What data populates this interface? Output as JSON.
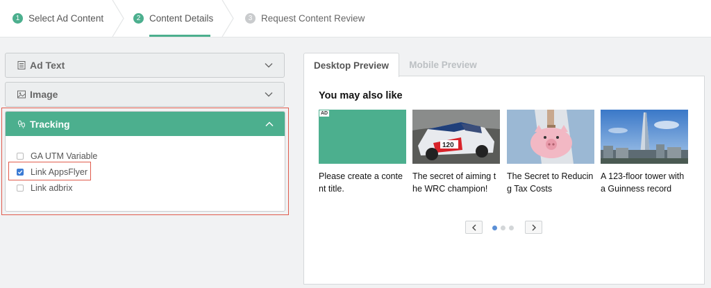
{
  "stepper": {
    "steps": [
      {
        "number": "1",
        "label": "Select Ad Content",
        "state": "done"
      },
      {
        "number": "2",
        "label": "Content Details",
        "state": "active"
      },
      {
        "number": "3",
        "label": "Request Content Review",
        "state": "todo"
      }
    ]
  },
  "sections": {
    "ad_text": {
      "label": "Ad Text",
      "icon": "document-icon",
      "expanded": false
    },
    "image": {
      "label": "Image",
      "icon": "image-icon",
      "expanded": false
    },
    "tracking": {
      "label": "Tracking",
      "icon": "footprints-icon",
      "expanded": true,
      "options": [
        {
          "label": "GA UTM Variable",
          "checked": false
        },
        {
          "label": "Link AppsFlyer",
          "checked": true
        },
        {
          "label": "Link adbrix",
          "checked": false
        }
      ]
    }
  },
  "preview": {
    "tabs": [
      {
        "label": "Desktop Preview",
        "active": true
      },
      {
        "label": "Mobile Preview",
        "active": false
      }
    ],
    "title": "You may also like",
    "cards": [
      {
        "title": "Please create a content title.",
        "badge": "AD",
        "thumb": "placeholder-green"
      },
      {
        "title": "The secret of aiming the WRC champion!",
        "thumb": "rally-car"
      },
      {
        "title": "The Secret to Reducing Tax Costs",
        "thumb": "piggy-bank"
      },
      {
        "title": "A 123-floor tower with a Guinness record",
        "thumb": "tower-skyline"
      }
    ],
    "pager": {
      "pages": 3,
      "current": 1
    }
  },
  "colors": {
    "accent": "#4caf8e",
    "highlight": "#e05a4b",
    "checkbox": "#3b7bd4",
    "dot_active": "#5b8fd6"
  }
}
